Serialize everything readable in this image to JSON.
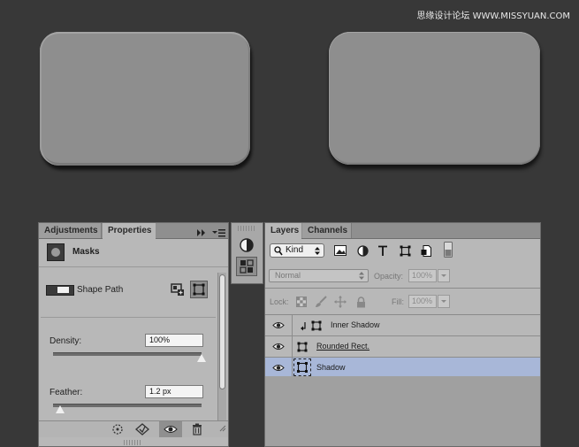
{
  "watermark": "思缘设计论坛 WWW.MISSYUAN.COM",
  "properties_panel": {
    "tabs": [
      {
        "label": "Adjustments"
      },
      {
        "label": "Properties"
      }
    ],
    "active_tab": "Properties",
    "masks_label": "Masks",
    "shape_path_label": "Shape Path",
    "density": {
      "label": "Density:",
      "value": "100%",
      "level": 1.0
    },
    "feather": {
      "label": "Feather:",
      "value": "1.2 px",
      "level": 0.05
    }
  },
  "layers_panel": {
    "tabs": [
      {
        "label": "Layers"
      },
      {
        "label": "Channels"
      }
    ],
    "active_tab": "Layers",
    "kind_filter": "Kind",
    "blend_mode": "Normal",
    "opacity_label": "Opacity:",
    "opacity_value": "100%",
    "lock_label": "Lock:",
    "fill_label": "Fill:",
    "fill_value": "100%",
    "layers": [
      {
        "name": "Inner Shadow",
        "clipped": true,
        "selected": false
      },
      {
        "name": "Rounded Rect.",
        "clipped": false,
        "selected": false
      },
      {
        "name": "Shadow",
        "clipped": false,
        "selected": true
      }
    ]
  },
  "colors": {
    "canvas": "#383838",
    "panel": "#b8b8b8",
    "selected_row": "#a8b7d8",
    "shape_fill": "#8e8e8e"
  }
}
